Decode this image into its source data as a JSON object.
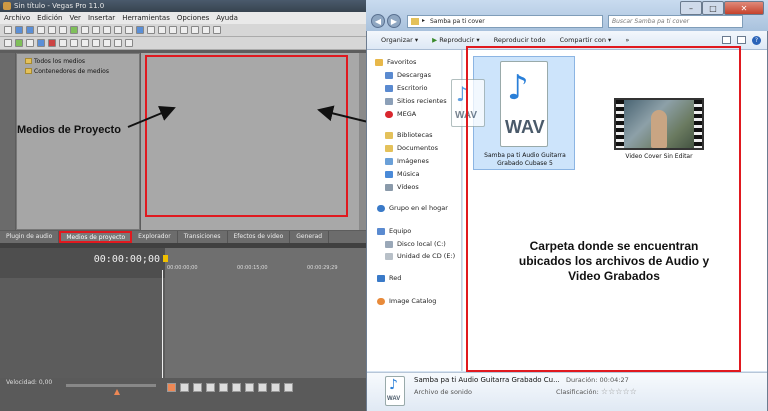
{
  "vegas": {
    "title": "Sin título - Vegas Pro 11.0",
    "menu": [
      "Archivo",
      "Edición",
      "Ver",
      "Insertar",
      "Herramientas",
      "Opciones",
      "Ayuda"
    ],
    "tree": [
      "Todos los medios",
      "Contenedores de medios"
    ],
    "tabs": [
      "Plugin de audio",
      "Medios de proyecto",
      "Explorador",
      "Transiciones",
      "Efectos de video",
      "Generad"
    ],
    "timecode": "00:00:00;00",
    "ruler": [
      "00:00:00;00",
      "00:00:15;00",
      "00:00:29;29"
    ],
    "rate": "Velocidad: 0,00"
  },
  "annotations": {
    "project_media": "Medios de Proyecto",
    "folder_note": "Carpeta donde se encuentran ubicados los archivos de Audio y Video Grabados"
  },
  "explorer": {
    "address": "Samba pa ti cover",
    "search_placeholder": "Buscar Samba pa ti cover",
    "toolbar": [
      "Organizar",
      "Reproducir",
      "Reproducir todo",
      "Compartir con"
    ],
    "nav": {
      "favorites_header": "Favoritos",
      "favorites": [
        "Descargas",
        "Escritorio",
        "Sitios recientes",
        "MEGA"
      ],
      "libraries_header": "Bibliotecas",
      "libraries": [
        "Documentos",
        "Imágenes",
        "Música",
        "Vídeos"
      ],
      "homegroup": "Grupo en el hogar",
      "computer_header": "Equipo",
      "computer": [
        "Disco local (C:)",
        "Unidad de CD (E:)"
      ],
      "network": "Red",
      "image_catalog": "Image Catalog"
    },
    "files": {
      "wav_name": "Samba pa ti Audio Guitarra Grabado Cubase 5",
      "wav_badge": "WAV",
      "video_name": "Video Cover Sin Editar"
    },
    "details": {
      "name": "Samba pa ti Audio Guitarra Grabado Cu...",
      "type": "Archivo de sonido",
      "duration_label": "Duración:",
      "duration_value": "00:04:27",
      "rating_label": "Clasificación:"
    }
  },
  "colors": {
    "annotation_box": "#e0191f",
    "selection": "#cde4fb"
  }
}
